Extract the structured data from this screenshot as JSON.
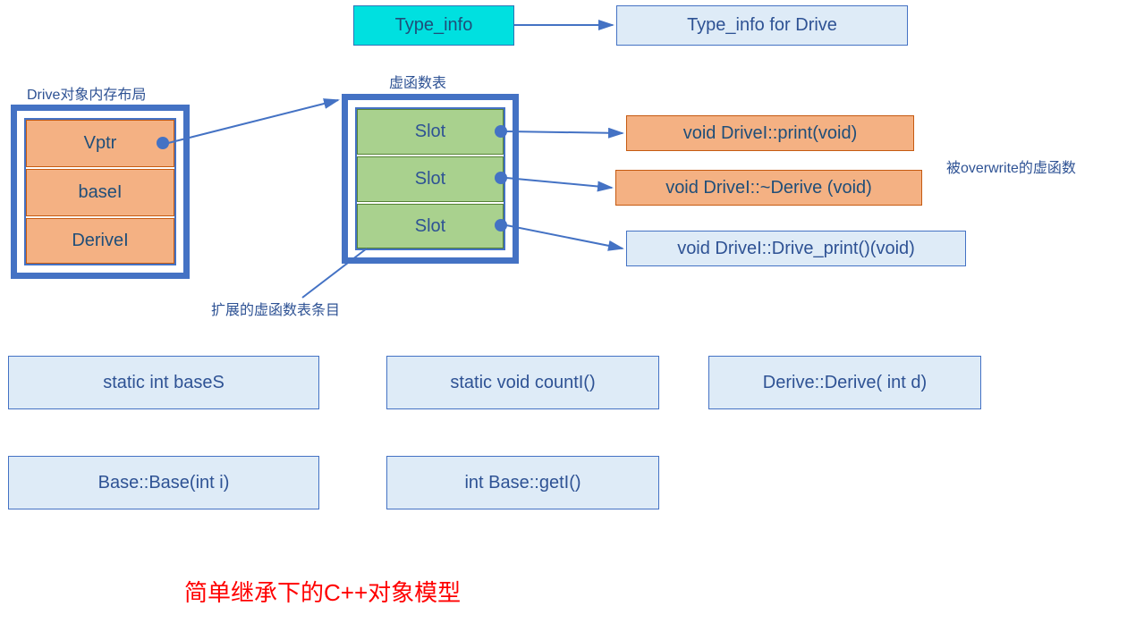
{
  "typeinfo": {
    "label": "Type_info",
    "target": "Type_info for Drive"
  },
  "memory_layout": {
    "title": "Drive对象内存布局",
    "rows": [
      "Vptr",
      "baseI",
      "DeriveI"
    ]
  },
  "vtable": {
    "title": "虚函数表",
    "slots": [
      "Slot",
      "Slot",
      "Slot"
    ],
    "expand_note": "扩展的虚函数表条目"
  },
  "functions": {
    "overwrite_note": "被overwrite的虚函数",
    "f0": "void DriveI::print(void)",
    "f1": "void DriveI::~Derive (void)",
    "f2": "void DriveI::Drive_print()(void)"
  },
  "bottom": {
    "b0": "static int baseS",
    "b1": "static void countI()",
    "b2": "Derive::Derive( int d)",
    "b3": "Base::Base(int i)",
    "b4": "int Base::getI()"
  },
  "title": "简单继承下的C++对象模型"
}
